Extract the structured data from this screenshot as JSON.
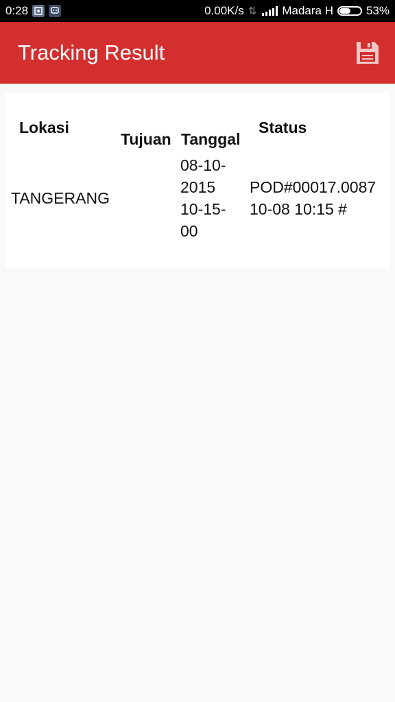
{
  "status_bar": {
    "time": "0:28",
    "net_speed": "0.00K/s",
    "carrier": "Madara H",
    "battery": "53%",
    "battery_level": 0.53,
    "left_icons": [
      "image-notification-icon",
      "bbm-notification-icon"
    ]
  },
  "toolbar": {
    "title": "Tracking Result",
    "save_icon": "save-icon",
    "color": "#d32f2f"
  },
  "table": {
    "headers": {
      "lokasi": "Lokasi",
      "tujuan": "Tujuan",
      "tanggal": "Tanggal",
      "status": "Status"
    },
    "rows": [
      {
        "lokasi": "TANGERANG",
        "tujuan": "",
        "tanggal_lines": [
          "08-10-",
          "2015",
          "10-15-",
          "00"
        ],
        "status_lines": [
          "POD#00017.0087",
          "10-08 10:15 #"
        ]
      }
    ]
  }
}
